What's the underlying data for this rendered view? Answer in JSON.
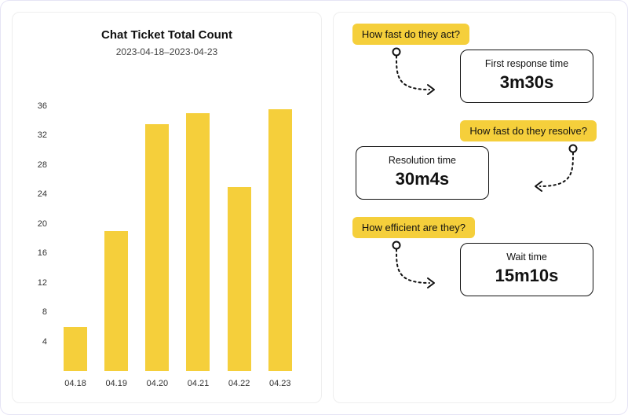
{
  "chart_data": {
    "type": "bar",
    "title": "Chat Ticket Total Count",
    "subtitle": "2023-04-18–2023-04-23",
    "categories": [
      "04.18",
      "04.19",
      "04.20",
      "04.21",
      "04.22",
      "04.23"
    ],
    "values": [
      6,
      19,
      33.5,
      35,
      25,
      35.5
    ],
    "ylim": [
      0,
      40
    ],
    "yticks": [
      4,
      8,
      12,
      16,
      20,
      24,
      28,
      32,
      36
    ],
    "xlabel": "",
    "ylabel": ""
  },
  "kpis": [
    {
      "question": "How fast do they act?",
      "metric": "First response time",
      "value": "3m30s",
      "align": "left"
    },
    {
      "question": "How fast do they resolve?",
      "metric": "Resolution time",
      "value": "30m4s",
      "align": "right"
    },
    {
      "question": "How efficient are they?",
      "metric": "Wait time",
      "value": "15m10s",
      "align": "left"
    }
  ],
  "colors": {
    "accent": "#f5cf3b"
  }
}
